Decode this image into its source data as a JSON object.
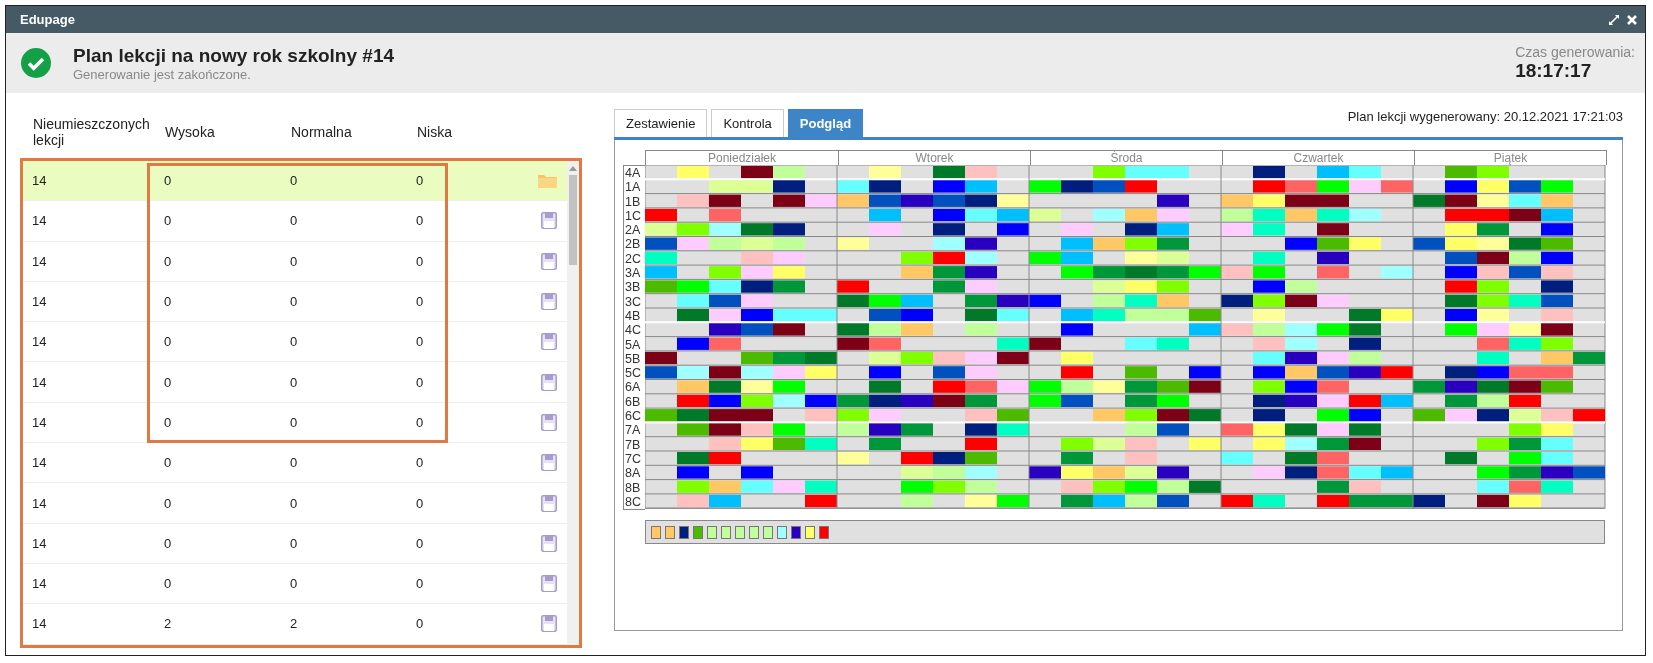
{
  "window": {
    "title": "Edupage"
  },
  "header": {
    "title": "Plan lekcji na nowy rok szkolny #14",
    "subtitle": "Generowanie jest zakończone.",
    "time_label": "Czas generowania:",
    "time": "18:17:17"
  },
  "table": {
    "columns": [
      "Nieumieszczonych lekcji",
      "Wysoka",
      "Normalna",
      "Niska"
    ],
    "rows": [
      {
        "unplaced": "14",
        "high": "0",
        "normal": "0",
        "low": "0",
        "selected": true,
        "kind": "folder"
      },
      {
        "unplaced": "14",
        "high": "0",
        "normal": "0",
        "low": "0",
        "selected": false,
        "kind": "save"
      },
      {
        "unplaced": "14",
        "high": "0",
        "normal": "0",
        "low": "0",
        "selected": false,
        "kind": "save"
      },
      {
        "unplaced": "14",
        "high": "0",
        "normal": "0",
        "low": "0",
        "selected": false,
        "kind": "save"
      },
      {
        "unplaced": "14",
        "high": "0",
        "normal": "0",
        "low": "0",
        "selected": false,
        "kind": "save"
      },
      {
        "unplaced": "14",
        "high": "0",
        "normal": "0",
        "low": "0",
        "selected": false,
        "kind": "save"
      },
      {
        "unplaced": "14",
        "high": "0",
        "normal": "0",
        "low": "0",
        "selected": false,
        "kind": "save"
      },
      {
        "unplaced": "14",
        "high": "0",
        "normal": "0",
        "low": "0",
        "selected": false,
        "kind": "save"
      },
      {
        "unplaced": "14",
        "high": "0",
        "normal": "0",
        "low": "0",
        "selected": false,
        "kind": "save"
      },
      {
        "unplaced": "14",
        "high": "0",
        "normal": "0",
        "low": "0",
        "selected": false,
        "kind": "save"
      },
      {
        "unplaced": "14",
        "high": "0",
        "normal": "0",
        "low": "0",
        "selected": false,
        "kind": "save"
      },
      {
        "unplaced": "14",
        "high": "2",
        "normal": "2",
        "low": "0",
        "selected": false,
        "kind": "save"
      }
    ]
  },
  "tabs": [
    {
      "label": "Zestawienie",
      "selected": false
    },
    {
      "label": "Kontrola",
      "selected": false
    },
    {
      "label": "Podgląd",
      "selected": true
    }
  ],
  "generated_note": "Plan lekcji wygenerowany: 20.12.2021 17:21:03",
  "timetable": {
    "days": [
      "Poniedziałek",
      "Wtorek",
      "Środa",
      "Czwartek",
      "Piątek"
    ],
    "classes": [
      "4A",
      "1A",
      "1B",
      "1C",
      "2A",
      "2B",
      "2C",
      "3A",
      "3B",
      "3C",
      "4B",
      "4C",
      "5A",
      "5B",
      "5C",
      "6A",
      "6B",
      "6C",
      "7A",
      "7B",
      "7C",
      "8A",
      "8B",
      "8C"
    ],
    "legend": [
      {
        "color": "#ffc864"
      },
      {
        "color": "#ffc864"
      },
      {
        "color": "#001e7e"
      },
      {
        "color": "#4cbb00"
      },
      {
        "color": "#c0ff99"
      },
      {
        "color": "#c0ff99"
      },
      {
        "color": "#c0ff99"
      },
      {
        "color": "#c0ff99"
      },
      {
        "color": "#c0ff99"
      },
      {
        "color": "#a0ffff"
      },
      {
        "color": "#2a00c0"
      },
      {
        "color": "#ffff66"
      },
      {
        "color": "#ff0000"
      }
    ]
  }
}
